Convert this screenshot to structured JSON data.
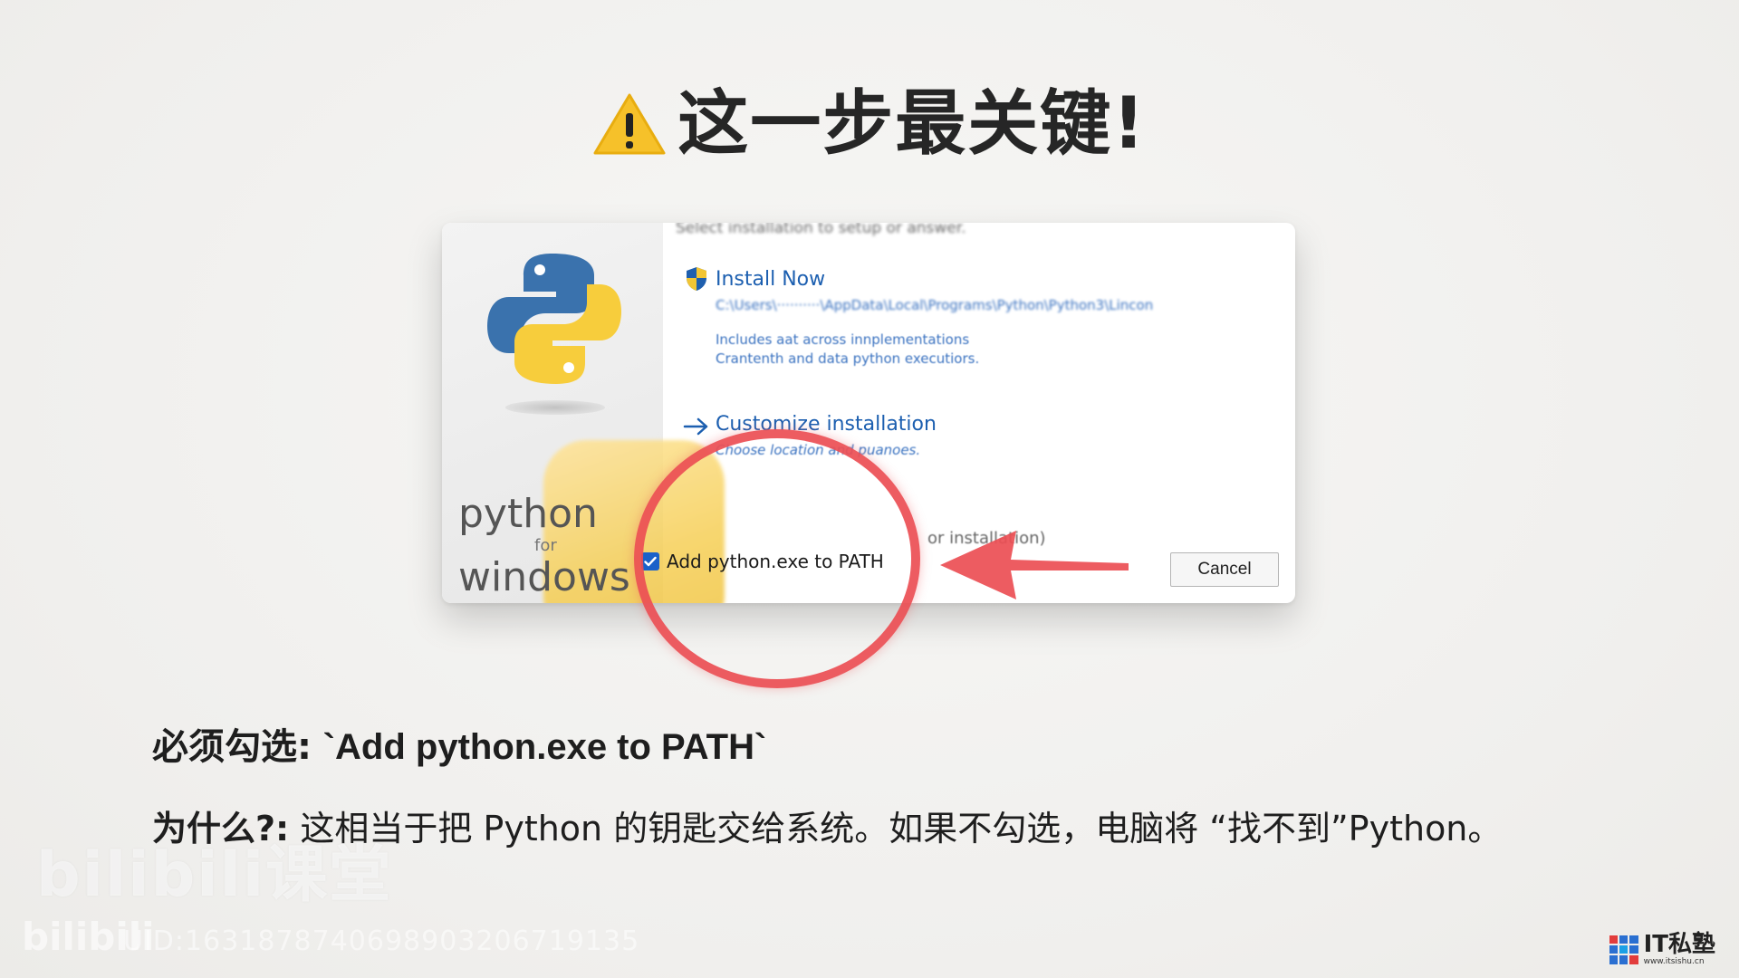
{
  "title": "这一步最关键!",
  "dialog": {
    "top_blur": "Select installation to setup or answer.",
    "brand_word1": "python",
    "brand_word2": "for",
    "brand_word3": "windows",
    "install_now": "Install Now",
    "install_path": "C:\\Users\\··········\\AppData\\Local\\Programs\\Python\\Python3\\Lincon",
    "install_desc1": "Includes aat across innplementations",
    "install_desc2": "Crantenth and data python executiors.",
    "customize": "Customize installation",
    "customize_sub": "Choose location and puanoes.",
    "for_installation": "or installation)",
    "path_checkbox_label": "Add python.exe to PATH",
    "path_checked": true,
    "cancel_label": "Cancel"
  },
  "body": {
    "line1_key": "必须勾选:",
    "line1_val": "`Add python.exe to PATH`",
    "line2_key": "为什么?:",
    "line2_val": "这相当于把 Python 的钥匙交给系统。如果不勾选，电脑将 “找不到”Python。"
  },
  "watermark": {
    "bili_big": "bilibili课堂",
    "bili_small": "bilibili",
    "uid": "UID:1631878740698903206719135"
  },
  "brand_logo": {
    "name": "IT私塾",
    "url": "www.itsishu.cn"
  },
  "colors": {
    "highlight_red": "#ec4e54",
    "link_blue": "#1c5fb0",
    "checkbox_blue": "#1a61c9",
    "warning_yellow": "#f6c12a"
  }
}
